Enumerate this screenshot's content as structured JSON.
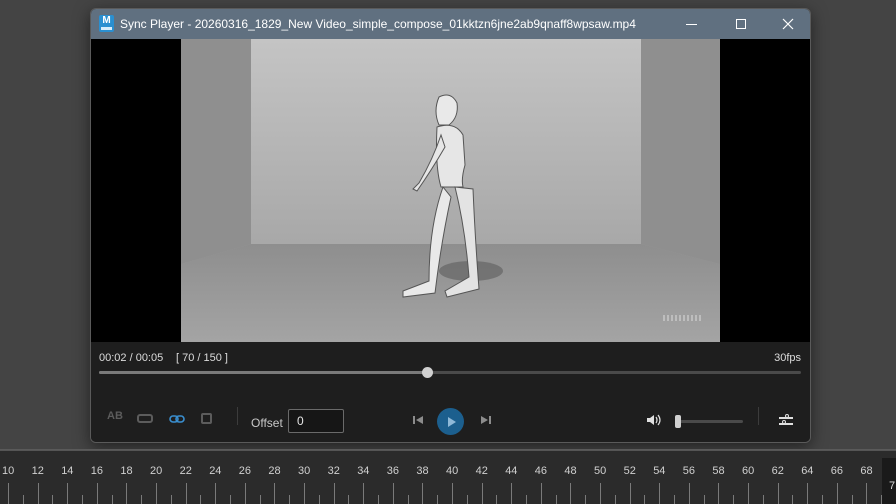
{
  "window": {
    "title": "Sync Player - 20260316_1829_New Video_simple_compose_01kktzn6jne2ab9qnaff8wpsaw.mp4",
    "app_icon_letter": "M",
    "controls": [
      "minimize-icon",
      "maximize-icon",
      "close-icon"
    ]
  },
  "playback": {
    "time": "00:02 / 00:05",
    "frames": "[ 70 / 150 ]",
    "fps": "30fps",
    "progress": 0.467
  },
  "toolbar": {
    "ab_label": "AB",
    "offset_label": "Offset",
    "offset_value": "0",
    "volume": 0.0
  },
  "timeline": {
    "labels": [
      "10",
      "12",
      "14",
      "16",
      "18",
      "20",
      "22",
      "24",
      "26",
      "28",
      "30",
      "32",
      "34",
      "36",
      "38",
      "40",
      "42",
      "44",
      "46",
      "48",
      "50",
      "52",
      "54",
      "56",
      "58",
      "60",
      "62",
      "64",
      "66",
      "68"
    ],
    "current_frame": "7"
  },
  "colors": {
    "titlebar": "#607080",
    "play_button": "#1c5f8e",
    "link_active": "#3a8fd0"
  }
}
